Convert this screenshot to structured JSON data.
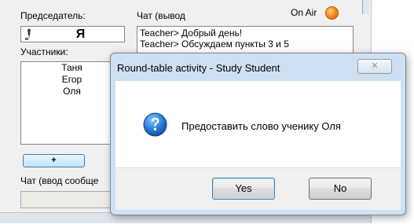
{
  "main": {
    "chair_label": "Председатель:",
    "chat_out_label": "Чат (вывод",
    "on_air_label": "On Air",
    "chair_name": "Я",
    "participants_label": "Участники:",
    "participants": [
      "Таня",
      "Егор",
      "Оля"
    ],
    "chat_lines": [
      "Teacher> Добрый день!",
      "Teacher> Обсуждаем пункты 3 и 5"
    ],
    "add_button_label": "+",
    "chat_in_label": "Чат (ввод сообще"
  },
  "dialog": {
    "title": "Round-table activity - Study Student",
    "close_label": "✕",
    "message": "Предоставить слово ученику Оля",
    "yes_label": "Yes",
    "no_label": "No"
  },
  "colors": {
    "on_air_indicator": "#f07a10",
    "question_icon": "#1f6fc5",
    "dialog_frame": "#cfe0f2",
    "panel_background": "#f0f0f0"
  },
  "icons": {
    "chair": "chair-pencil-icon",
    "on_air": "on-air-indicator-icon",
    "dialog_info": "question-icon",
    "close": "close-icon"
  }
}
